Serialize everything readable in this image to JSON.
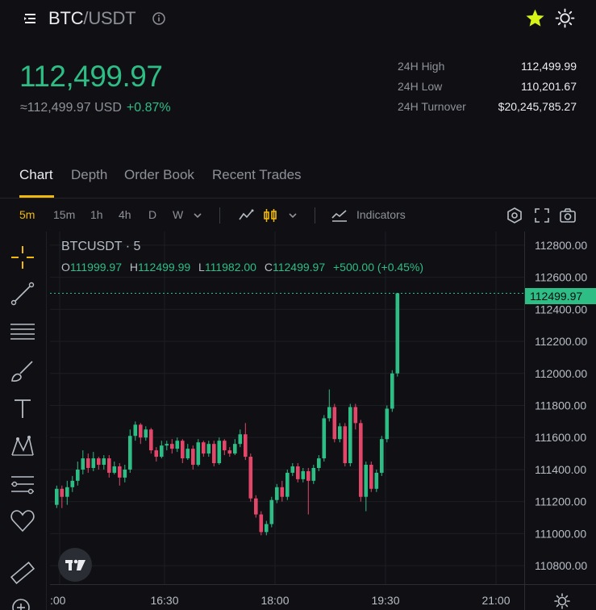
{
  "header": {
    "pair_base": "BTC",
    "pair_sep": "/",
    "pair_quote": "USDT",
    "icons": [
      "menu-icon",
      "info-icon",
      "star-icon",
      "sun-icon"
    ]
  },
  "price": {
    "last": "112,499.97",
    "approx": "≈112,499.97 USD",
    "change_pct": "+0.87%"
  },
  "stats": [
    {
      "label": "24H High",
      "value": "112,499.99"
    },
    {
      "label": "24H Low",
      "value": "110,201.67"
    },
    {
      "label": "24H Turnover",
      "value": "$20,245,785.27"
    }
  ],
  "tabs": [
    "Chart",
    "Depth",
    "Order Book",
    "Recent Trades"
  ],
  "timeframes": [
    "5m",
    "15m",
    "1h",
    "4h",
    "D",
    "W"
  ],
  "toolbar": {
    "indicators_label": "Indicators"
  },
  "chart": {
    "symbol_label": "BTCUSDT · 5",
    "ohlc": {
      "o_key": "O",
      "o": "111999.97",
      "h_key": "H",
      "h": "112499.99",
      "l_key": "L",
      "l": "111982.00",
      "c_key": "C",
      "c": "112499.97",
      "change": "+500.00 (+0.45%)"
    },
    "last_price_tag": "112499.97"
  },
  "chart_data": {
    "type": "candlestick",
    "y_ticks": [
      "112800.00",
      "112600.00",
      "112400.00",
      "112200.00",
      "112000.00",
      "111800.00",
      "111600.00",
      "111400.00",
      "111200.00",
      "111000.00",
      "110800.00"
    ],
    "x_ticks": [
      ":00",
      "16:30",
      "18:00",
      "19:30",
      "21:00"
    ],
    "ylim": [
      110700,
      112900
    ],
    "last_price": 112499.97,
    "candles": [
      [
        111180,
        111280,
        111160,
        111300
      ],
      [
        111280,
        111230,
        111160,
        111300
      ],
      [
        111230,
        111290,
        111180,
        111330
      ],
      [
        111290,
        111330,
        111260,
        111360
      ],
      [
        111330,
        111400,
        111300,
        111450
      ],
      [
        111400,
        111470,
        111370,
        111520
      ],
      [
        111470,
        111410,
        111380,
        111500
      ],
      [
        111410,
        111470,
        111390,
        111510
      ],
      [
        111470,
        111430,
        111400,
        111480
      ],
      [
        111430,
        111470,
        111400,
        111490
      ],
      [
        111470,
        111380,
        111350,
        111490
      ],
      [
        111380,
        111420,
        111370,
        111450
      ],
      [
        111420,
        111350,
        111300,
        111440
      ],
      [
        111350,
        111400,
        111320,
        111430
      ],
      [
        111400,
        111610,
        111380,
        111650
      ],
      [
        111610,
        111680,
        111580,
        111700
      ],
      [
        111680,
        111600,
        111560,
        111690
      ],
      [
        111600,
        111650,
        111580,
        111670
      ],
      [
        111650,
        111520,
        111500,
        111660
      ],
      [
        111520,
        111480,
        111450,
        111540
      ],
      [
        111480,
        111550,
        111470,
        111580
      ],
      [
        111550,
        111560,
        111520,
        111580
      ],
      [
        111560,
        111530,
        111500,
        111590
      ],
      [
        111530,
        111580,
        111510,
        111600
      ],
      [
        111580,
        111470,
        111440,
        111590
      ],
      [
        111470,
        111530,
        111460,
        111560
      ],
      [
        111530,
        111430,
        111400,
        111550
      ],
      [
        111430,
        111570,
        111420,
        111590
      ],
      [
        111570,
        111500,
        111480,
        111580
      ],
      [
        111500,
        111560,
        111480,
        111580
      ],
      [
        111560,
        111440,
        111420,
        111580
      ],
      [
        111440,
        111580,
        111430,
        111600
      ],
      [
        111580,
        111520,
        111490,
        111590
      ],
      [
        111520,
        111500,
        111480,
        111540
      ],
      [
        111500,
        111560,
        111490,
        111590
      ],
      [
        111560,
        111620,
        111540,
        111650
      ],
      [
        111620,
        111480,
        111460,
        111690
      ],
      [
        111480,
        111220,
        111200,
        111500
      ],
      [
        111220,
        111120,
        111100,
        111240
      ],
      [
        111120,
        111010,
        110990,
        111140
      ],
      [
        111010,
        111060,
        110990,
        111080
      ],
      [
        111060,
        111210,
        111040,
        111230
      ],
      [
        111210,
        111290,
        111190,
        111310
      ],
      [
        111290,
        111230,
        111200,
        111330
      ],
      [
        111230,
        111380,
        111210,
        111400
      ],
      [
        111380,
        111420,
        111360,
        111440
      ],
      [
        111420,
        111340,
        111320,
        111440
      ],
      [
        111340,
        111390,
        111320,
        111410
      ],
      [
        111390,
        111330,
        111120,
        111410
      ],
      [
        111330,
        111410,
        111310,
        111430
      ],
      [
        111410,
        111470,
        111390,
        111490
      ],
      [
        111470,
        111720,
        111450,
        111740
      ],
      [
        111720,
        111790,
        111700,
        111900
      ],
      [
        111790,
        111590,
        111570,
        111810
      ],
      [
        111590,
        111670,
        111570,
        111690
      ],
      [
        111670,
        111440,
        111420,
        111690
      ],
      [
        111440,
        111790,
        111420,
        111810
      ],
      [
        111790,
        111690,
        111650,
        111810
      ],
      [
        111690,
        111230,
        111200,
        111710
      ],
      [
        111230,
        111430,
        111140,
        111450
      ],
      [
        111430,
        111280,
        111260,
        111450
      ],
      [
        111280,
        111380,
        111260,
        111400
      ],
      [
        111380,
        111590,
        111360,
        111610
      ],
      [
        111590,
        111780,
        111570,
        111800
      ],
      [
        111780,
        112000,
        111760,
        112020
      ],
      [
        112000,
        112500,
        111980,
        112500
      ]
    ]
  },
  "colors": {
    "up": "#2ebd85",
    "down": "#e2476a",
    "accent": "#f0b90b",
    "star": "#d6f416",
    "background": "#101014"
  }
}
